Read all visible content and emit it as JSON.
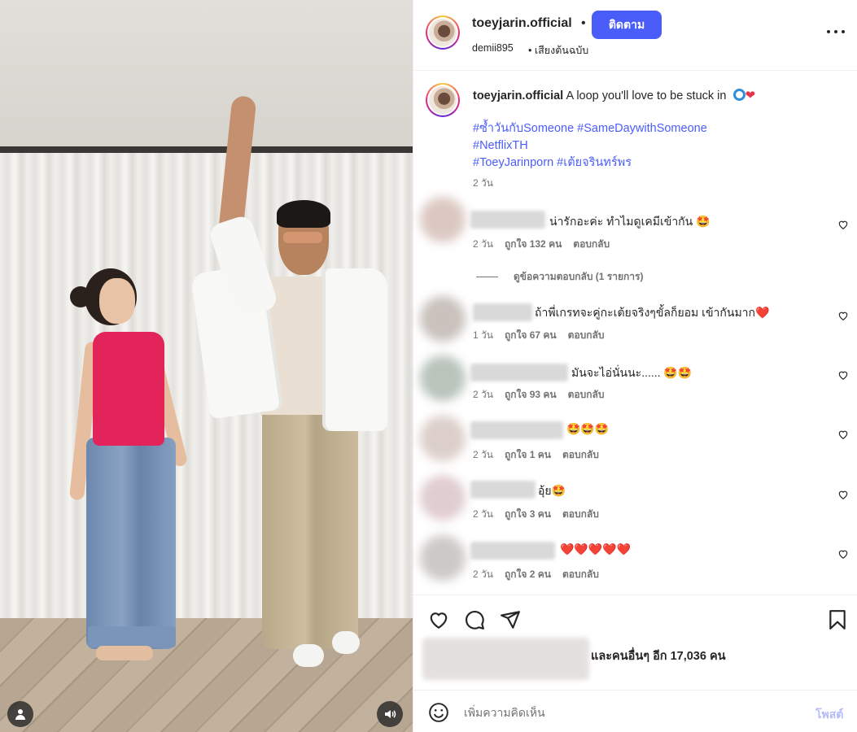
{
  "post": {
    "username": "toeyjarin.official",
    "follow_label": "ติดตาม",
    "audio_user": "demii895",
    "audio_title": "เสียงต้นฉบับ"
  },
  "caption": {
    "username": "toeyjarin.official",
    "text": "A loop you'll love to be stuck in",
    "hashtag_line1": "#ซ้ำวันกับSomeone #SameDaywithSomeone",
    "hashtag_line2": "#NetflixTH",
    "hashtag_line3": "#ToeyJarinporn #เต้ยจรินทร์พร",
    "time": "2 วัน"
  },
  "comments": [
    {
      "text": "น่ารักอะค่ะ ทำไมดูเคมีเข้ากัน 🤩",
      "time": "2 วัน",
      "likes": "ถูกใจ 132 คน",
      "reply": "ตอบกลับ",
      "avatar_color": "#dcc8c2"
    },
    {
      "text": "ถ้าพี่เกรทจะคู่กะเต้ยจริงๆขั้ลก็ยอม เข้ากันมาก❤️",
      "time": "1 วัน",
      "likes": "ถูกใจ 67 คน",
      "reply": "ตอบกลับ",
      "avatar_color": "#c9c2bd"
    },
    {
      "text": "มันจะไอ่นั่นนะ...... 🤩🤩",
      "time": "2 วัน",
      "likes": "ถูกใจ 93 คน",
      "reply": "ตอบกลับ",
      "avatar_color": "#b9c4bb"
    },
    {
      "text": "🤩🤩🤩",
      "time": "2 วัน",
      "likes": "ถูกใจ 1 คน",
      "reply": "ตอบกลับ",
      "avatar_color": "#dccfc9"
    },
    {
      "text": "อุ้ย🤩",
      "time": "2 วัน",
      "likes": "ถูกใจ 3 คน",
      "reply": "ตอบกลับ",
      "avatar_color": "#e0cdd0"
    },
    {
      "text": "❤️❤️❤️❤️❤️",
      "time": "2 วัน",
      "likes": "ถูกใจ 2 คน",
      "reply": "ตอบกลับ",
      "avatar_color": "#cdc9c7"
    }
  ],
  "view_replies": "ดูข้อความตอบกลับ (1 รายการ)",
  "likes_text": "และคนอื่นๆ อีก 17,036 คน",
  "add_comment": {
    "placeholder": "เพิ่มความคิดเห็น",
    "post_label": "โพสต์"
  },
  "colors": {
    "accent": "#4a5df9",
    "hashtag": "#4a5df9",
    "muted_text": "#737373",
    "post_disabled": "#b3bcf9"
  },
  "icons": [
    "user-tag-icon",
    "sound-on-icon",
    "more-options-icon",
    "heart-icon",
    "comment-icon",
    "share-icon",
    "bookmark-icon",
    "emoji-icon"
  ]
}
